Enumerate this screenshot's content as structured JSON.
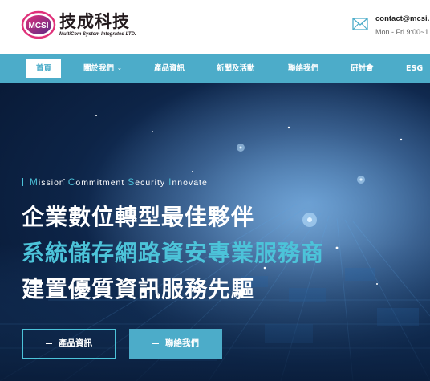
{
  "header": {
    "brand_name": "技成科技",
    "brand_sub": "MultiCom System Integrated LTD.",
    "logo_text": "MCSI",
    "contact_email": "contact@mcsi.",
    "contact_hours": "Mon - Fri 9:00~1"
  },
  "nav": {
    "items": [
      {
        "label": "首頁",
        "active": true
      },
      {
        "label": "關於我們",
        "has_dropdown": true
      },
      {
        "label": "產品資訊"
      },
      {
        "label": "新聞及活動"
      },
      {
        "label": "聯絡我們"
      },
      {
        "label": "研討會"
      },
      {
        "label": "ESG"
      }
    ],
    "dropdown_icon": "chevron-down-icon"
  },
  "hero": {
    "tagline_parts": [
      {
        "cap": "M",
        "rest": "ission"
      },
      {
        "cap": "C",
        "rest": "ommitment"
      },
      {
        "cap": "S",
        "rest": "ecurity"
      },
      {
        "cap": "I",
        "rest": "nnovate"
      }
    ],
    "headline_1": "企業數位轉型最佳夥伴",
    "headline_2": "系統儲存網路資安專業服務商",
    "headline_3": "建置優質資訊服務先驅",
    "button_products": "產品資訊",
    "button_contact": "聯絡我們"
  },
  "colors": {
    "accent": "#4cacc9",
    "accent_light": "#4cc3d9",
    "hero_dark": "#0d2447"
  }
}
